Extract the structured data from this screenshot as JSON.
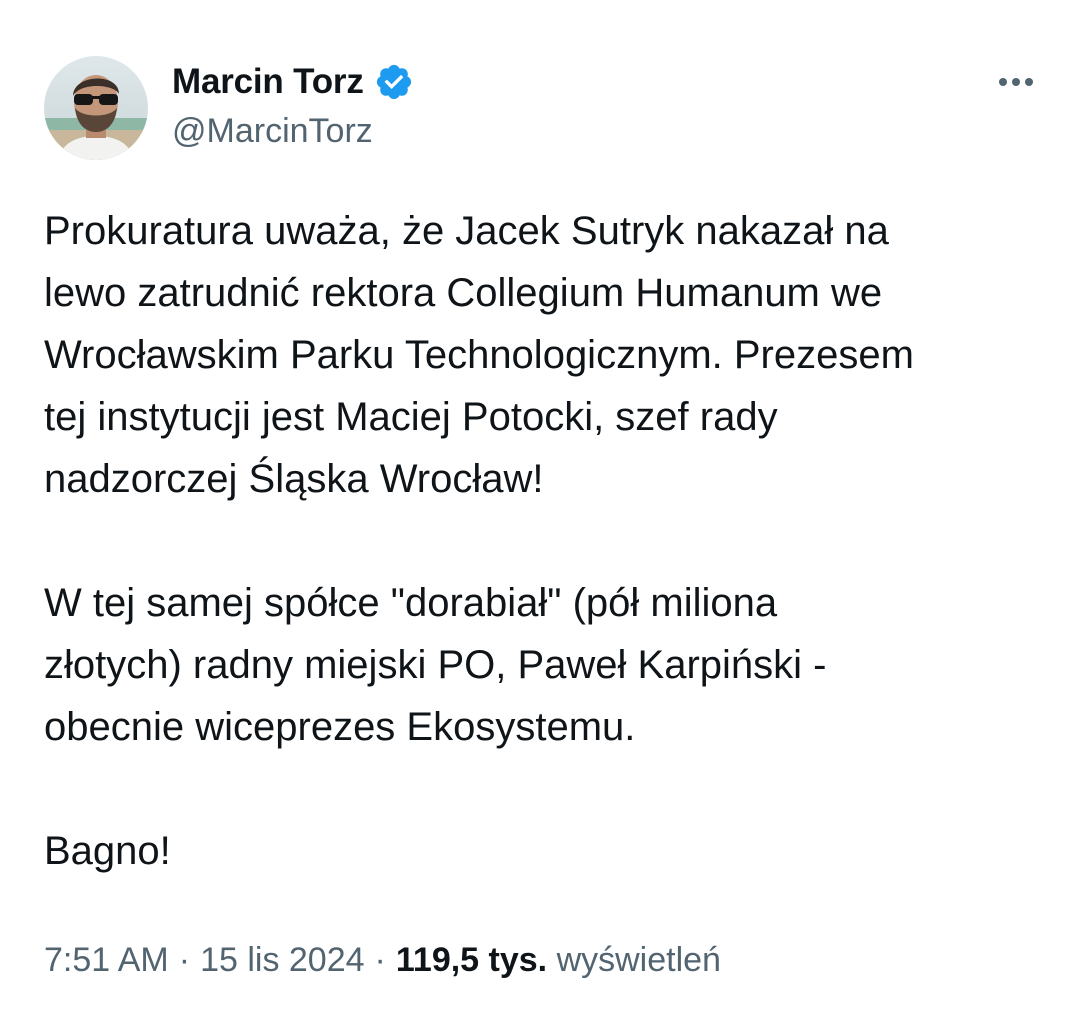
{
  "author": {
    "display_name": "Marcin Torz",
    "handle": "@MarcinTorz",
    "verified": true,
    "avatar_icon": "profile-photo-man-sunglasses"
  },
  "more_icon": "more-horizontal-icon",
  "tweet": {
    "paragraphs": [
      "Prokuratura uważa, że Jacek Sutryk nakazał na\nlewo zatrudnić rektora Collegium Humanum we\nWrocławskim Parku Technologicznym. Prezesem\ntej instytucji jest Maciej Potocki, szef rady\nnadzorczej Śląska Wrocław!",
      "W tej samej spółce \"dorabiał\" (pół miliona\nzłotych) radny miejski PO, Paweł Karpiński -\nobecnie wiceprezes Ekosystemu.",
      "Bagno!"
    ]
  },
  "meta": {
    "time": "7:51 AM",
    "separator": "·",
    "date": "15 lis 2024",
    "views_count": "119,5 tys.",
    "views_label": "wyświetleń"
  },
  "colors": {
    "text_primary": "#0f1419",
    "text_secondary": "#536471",
    "verified_blue": "#1d9bf0",
    "background": "#ffffff"
  }
}
